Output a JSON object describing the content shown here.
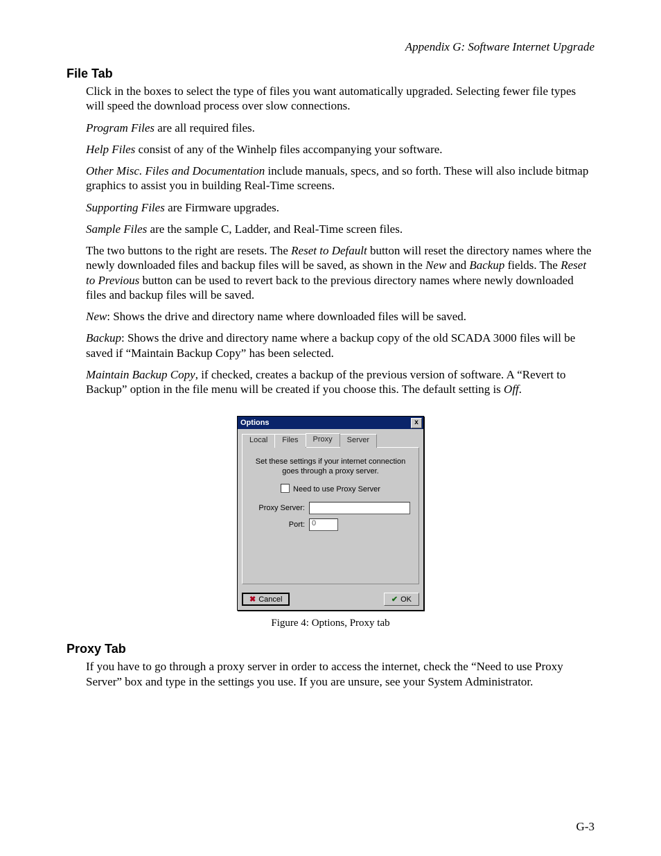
{
  "header": {
    "running_head": "Appendix G: Software Internet Upgrade"
  },
  "sections": {
    "file_tab_heading": "File Tab",
    "proxy_tab_heading": "Proxy Tab"
  },
  "file_tab": {
    "p1": "Click in the boxes to select the type of files you want automatically upgraded. Selecting fewer file types will speed the download process over slow connections.",
    "p2_i": "Program Files",
    "p2_rest": " are all required files.",
    "p3_i": "Help Files",
    "p3_rest": " consist of any of the Winhelp files accompanying your software.",
    "p4_i": "Other Misc. Files and Documentation",
    "p4_rest": " include manuals, specs, and so forth.  These will also include bitmap graphics to assist you in building Real-Time screens.",
    "p5_i": "Supporting Files",
    "p5_rest": " are Firmware upgrades.",
    "p6_i": "Sample Files",
    "p6_rest": " are the sample C, Ladder, and Real-Time screen files.",
    "p7_a": "The two buttons to the right are resets.  The ",
    "p7_b_i": "Reset to Default",
    "p7_c": " button will reset the directory names where the newly downloaded files and backup files will be saved, as shown in the ",
    "p7_d_i": "New",
    "p7_e": " and ",
    "p7_f_i": "Backup",
    "p7_g": " fields. The ",
    "p7_h_i": "Reset to Previous",
    "p7_i_txt": " button can be used to revert back to the previous directory names where newly downloaded files and backup files will be saved.",
    "p8_i": "New",
    "p8_rest": ": Shows the drive and directory name where downloaded files will be saved.",
    "p9_i": "Backup",
    "p9_rest": ": Shows the drive and directory name where a backup copy of the old SCADA 3000 files will be saved if “Maintain Backup Copy” has been selected.",
    "p10_i": "Maintain Backup Copy",
    "p10_mid": ", if checked, creates a backup of the previous version of software.  A “Revert to Backup” option in the file menu will be created if you choose this.  The default setting is ",
    "p10_off_i": "Off",
    "p10_end": "."
  },
  "figure": {
    "caption": "Figure 4: Options, Proxy tab"
  },
  "dialog": {
    "title": "Options",
    "close_glyph": "x",
    "tabs": {
      "local": "Local",
      "files": "Files",
      "proxy": "Proxy",
      "server": "Server"
    },
    "message": "Set these settings if your internet connection goes through a proxy server.",
    "checkbox_label": "Need to use Proxy Server",
    "proxy_server_label": "Proxy Server:",
    "proxy_server_value": "",
    "port_label": "Port:",
    "port_value": "0",
    "cancel_label": "Cancel",
    "ok_label": "OK"
  },
  "proxy_tab": {
    "p1": "If you have to go through a proxy server in order to access the internet, check the “Need to use Proxy Server” box and type in the settings you use.  If you are unsure, see your System Administrator."
  },
  "page_number": "G-3"
}
